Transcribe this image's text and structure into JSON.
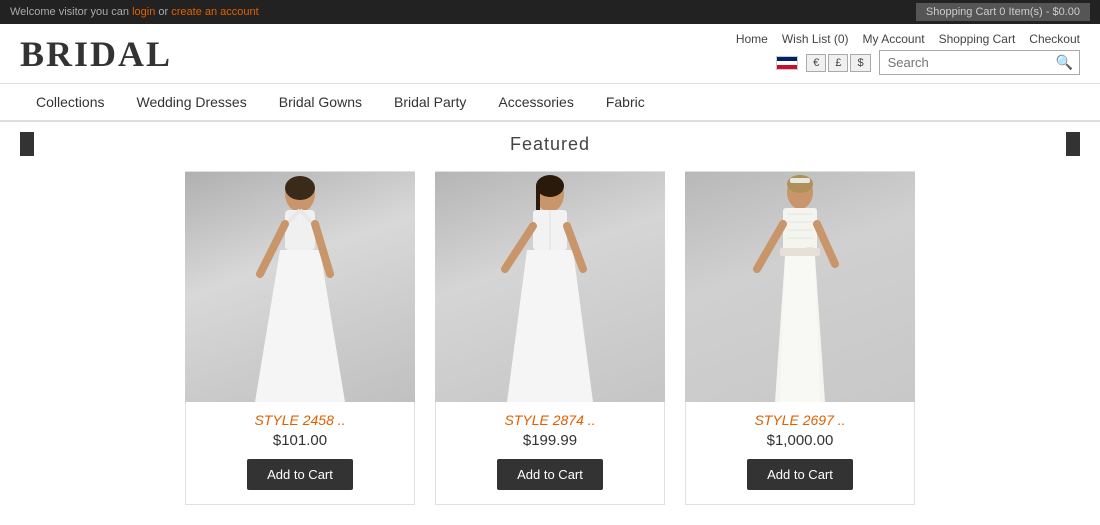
{
  "topbar": {
    "welcome_text": "Welcome visitor you can ",
    "login_label": "login",
    "or_text": " or ",
    "create_account_label": "create an account",
    "cart_label": "Shopping Cart  0 Item(s) - $0.00"
  },
  "header": {
    "logo": "BRIDAL",
    "nav": {
      "home": "Home",
      "wishlist": "Wish List (0)",
      "my_account": "My Account",
      "shopping_cart": "Shopping Cart",
      "checkout": "Checkout"
    },
    "currencies": [
      "€",
      "£",
      "$"
    ],
    "search": {
      "placeholder": "Search",
      "button_icon": "🔍"
    }
  },
  "navbar": {
    "items": [
      {
        "label": "Collections"
      },
      {
        "label": "Wedding Dresses"
      },
      {
        "label": "Bridal Gowns"
      },
      {
        "label": "Bridal Party"
      },
      {
        "label": "Accessories"
      },
      {
        "label": "Fabric"
      }
    ]
  },
  "featured": {
    "title": "Featured",
    "products": [
      {
        "style": "STYLE 2458 ..",
        "price": "$101.00",
        "add_to_cart": "Add to Cart"
      },
      {
        "style": "STYLE 2874 ..",
        "price": "$199.99",
        "add_to_cart": "Add to Cart"
      },
      {
        "style": "STYLE 2697 ..",
        "price": "$1,000.00",
        "add_to_cart": "Add to Cart"
      }
    ]
  }
}
